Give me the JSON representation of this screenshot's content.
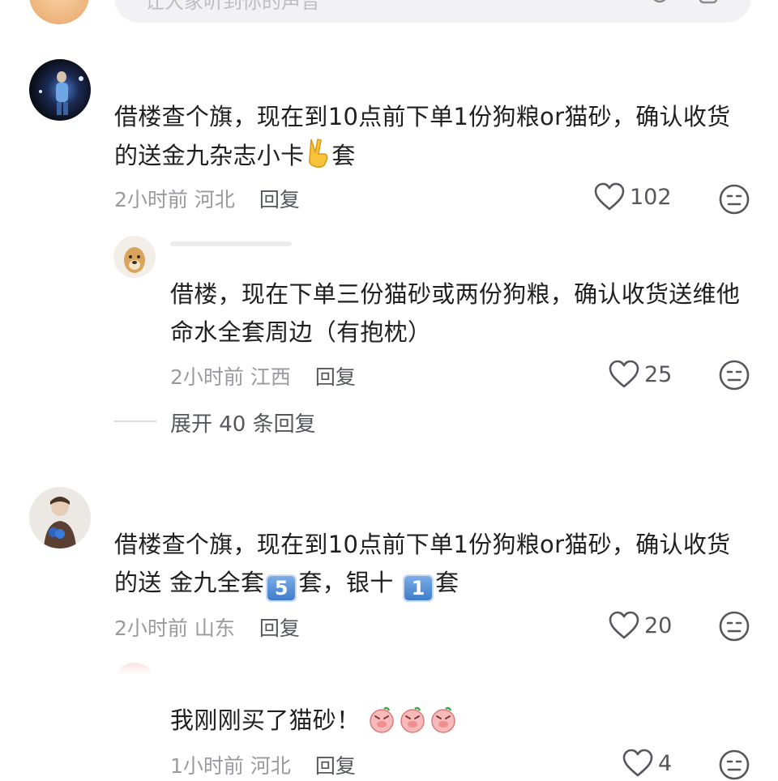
{
  "input": {
    "placeholder": "让大家听到你的声音"
  },
  "comments": [
    {
      "text": "借楼查个旗，现在到10点前下单1份狗粮or猫砂，确认收货的送金九杂志小卡",
      "emoji": "victory-hand",
      "text_after": "套",
      "time": "2小时前",
      "location": "河北",
      "reply_label": "回复",
      "likes": "102"
    },
    {
      "text": "借楼，现在下单三份猫砂或两份狗粮，确认收货送维他命水全套周边（有抱枕）",
      "time": "2小时前",
      "location": "江西",
      "reply_label": "回复",
      "likes": "25"
    },
    {
      "text_part1": "借楼查个旗，现在到10点前下单1份狗粮or猫砂，确认收货的送 金九全套",
      "keycap1": "5",
      "text_part2": "套，银十",
      "keycap2": "1",
      "text_part3": "套",
      "time": "2小时前",
      "location": "山东",
      "reply_label": "回复",
      "likes": "20"
    },
    {
      "text": "我刚刚买了猫砂！",
      "stickers": [
        "pig-sticker",
        "pig-sticker",
        "pig-sticker"
      ],
      "time": "1小时前",
      "location": "河北",
      "reply_label": "回复",
      "likes": "4"
    }
  ],
  "expand": {
    "label": "展开 40 条回复"
  },
  "colors": {
    "text": "#1f1f1f",
    "meta": "#9a9aa0",
    "icon": "#55575c"
  }
}
